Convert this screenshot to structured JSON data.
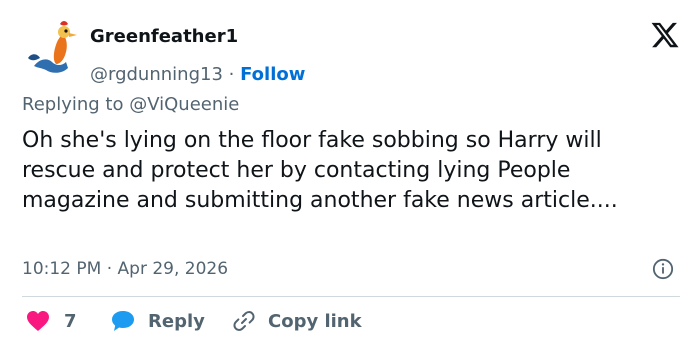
{
  "user": {
    "display_name": "Greenfeather1",
    "handle": "@rgdunning13",
    "separator": "·",
    "follow_label": "Follow"
  },
  "reply": {
    "prefix": "Replying to",
    "mention": "@ViQueenie"
  },
  "tweet": {
    "text": "Oh she's lying on the floor fake sobbing so Harry will rescue and protect her by contacting lying People magazine and submitting another fake news article....",
    "timestamp": "10:12 PM · Apr 29, 2026"
  },
  "actions": {
    "likes_count": "7",
    "reply_label": "Reply",
    "copy_label": "Copy link"
  },
  "colors": {
    "accent": "#006fd6",
    "like": "#f91880",
    "reply_icon": "#1d9bf0",
    "muted": "#536471"
  },
  "icons": [
    "rooster-avatar",
    "x-logo-icon",
    "info-icon",
    "heart-icon",
    "reply-bubble-icon",
    "link-icon"
  ]
}
